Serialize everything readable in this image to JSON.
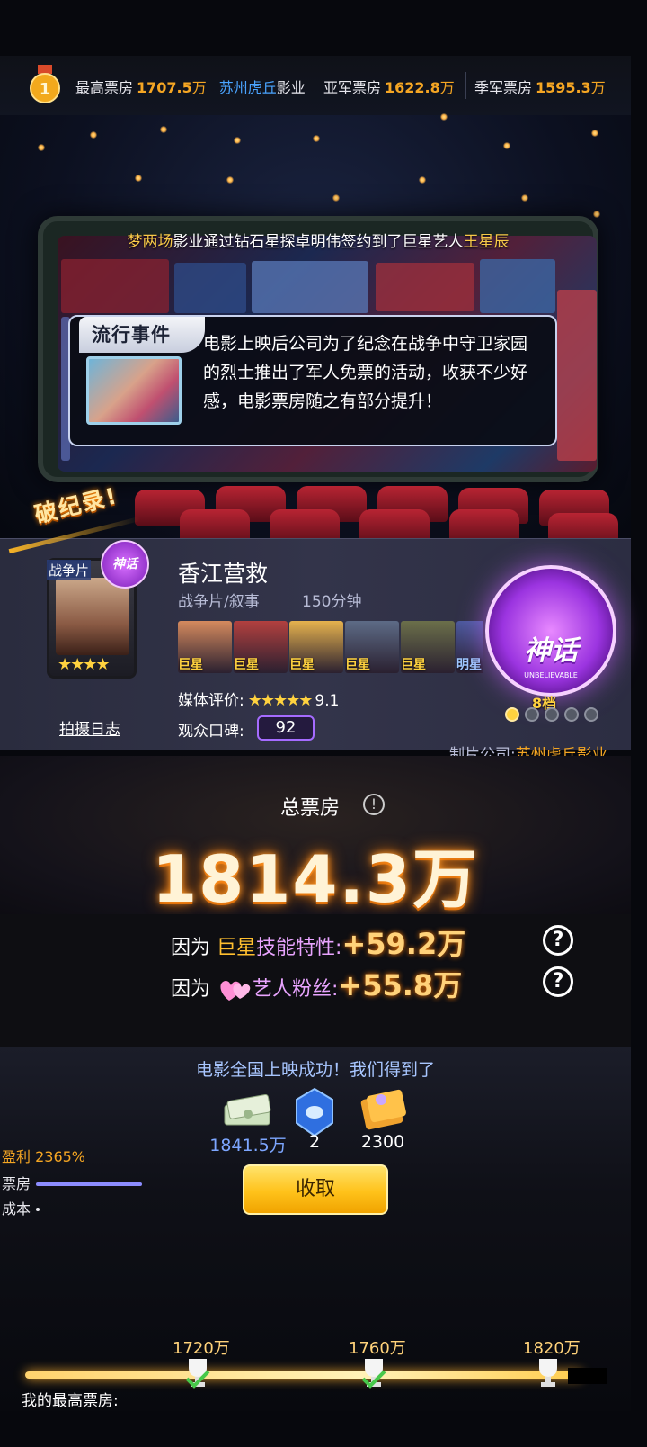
{
  "top_bar": {
    "best_label": "最高票房",
    "best_value": "1707.5",
    "best_unit": "万",
    "best_company_a": "苏州虎丘",
    "best_company_b": "影业",
    "second_label": "亚军票房",
    "second_value": "1622.8",
    "second_unit": "万",
    "third_label": "季军票房",
    "third_value": "1595.3",
    "third_unit": "万"
  },
  "marquee": {
    "a": "梦两场",
    "b": "影业通过钻石星探卓明伟签约到了巨星艺人",
    "c": "王星辰"
  },
  "event": {
    "title": "流行事件",
    "text": "电影上映后公司为了纪念在战争中守卫家园的烈士推出了军人免票的活动，收获不少好感，电影票房随之有部分提升！"
  },
  "record_ribbon": "破纪录!",
  "movie": {
    "card_genre": "战争片",
    "card_badge": "神话",
    "card_stars": "★★★★",
    "shoot_log": "拍摄日志",
    "title": "香江营救",
    "genre": "战争片/叙事",
    "length": "150分钟",
    "actors": [
      {
        "tag": "巨星",
        "color": "#d58a5e"
      },
      {
        "tag": "巨星",
        "color": "#b2403f"
      },
      {
        "tag": "巨星",
        "color": "#e6b24e"
      },
      {
        "tag": "巨星",
        "color": "#5d6b86"
      },
      {
        "tag": "巨星",
        "color": "#6b6f4a"
      },
      {
        "tag": "明星",
        "color": "#4c5a9e"
      }
    ],
    "media_label": "媒体评价:",
    "media_stars": "★★★★★",
    "media_score": "9.1",
    "audience_label": "观众口碑:",
    "audience_score": "92",
    "producer_label": "制片公司:",
    "producer": "苏州虎丘影业"
  },
  "myth_badge": {
    "title": "神话",
    "sub": "UNBELIEVABLE",
    "level": "8档",
    "level_fill": 1,
    "level_total": 5
  },
  "box_office": {
    "label": "总票房",
    "info_icon": "!",
    "total": "1814.3万"
  },
  "bonuses": [
    {
      "prefix": "因为 ",
      "highlight": "巨星",
      "suffix": "技能特性:",
      "amount": "+59.2万"
    },
    {
      "prefix": "因为 ",
      "highlight": "",
      "suffix": "艺人粉丝:",
      "amount": "+55.8万"
    }
  ],
  "reward": {
    "message": "电影全国上映成功！我们得到了",
    "money": "1841.5万",
    "gems": "2",
    "tickets": "2300",
    "collect": "收取"
  },
  "side_stats": {
    "profit": "盈利 2365%",
    "box_label": "票房",
    "cost_label": "成本"
  },
  "milestones": [
    "1720万",
    "1760万",
    "1820万"
  ],
  "best_label": "我的最高票房:"
}
